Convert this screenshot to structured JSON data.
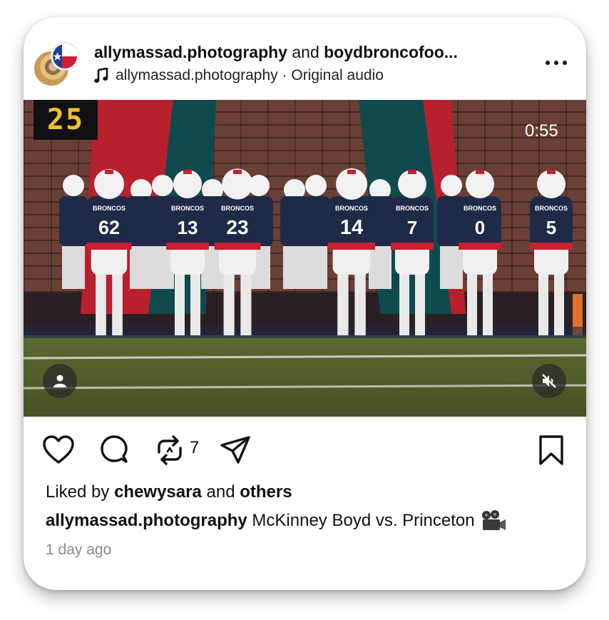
{
  "header": {
    "author_primary": "allymassad.photography",
    "connector": " and ",
    "author_secondary": "boydbroncofoo...",
    "audio_owner": "allymassad.photography",
    "audio_separator": " · ",
    "audio_label": "Original audio"
  },
  "video": {
    "scoreboard_text": "25",
    "duration": "0:55",
    "player_numbers": [
      "62",
      "13",
      "23",
      "14",
      "7",
      "0",
      "5"
    ],
    "team_name": "BRONCOS"
  },
  "actions": {
    "repost_count": "7"
  },
  "likes": {
    "prefix": "Liked by ",
    "user": "chewysara",
    "middle": " and ",
    "others": "others"
  },
  "caption": {
    "user": "allymassad.photography",
    "text": "McKinney Boyd vs. Princeton"
  },
  "timestamp": "1 day ago",
  "colors": {
    "jersey": "#1f2a48",
    "accent_red": "#c8202e",
    "helmet": "#f2f2f2"
  },
  "icons": [
    "more-icon",
    "music-note-icon",
    "user-tag-icon",
    "muted-icon",
    "heart-icon",
    "comment-icon",
    "repost-icon",
    "send-icon",
    "bookmark-icon",
    "movie-camera-icon"
  ]
}
